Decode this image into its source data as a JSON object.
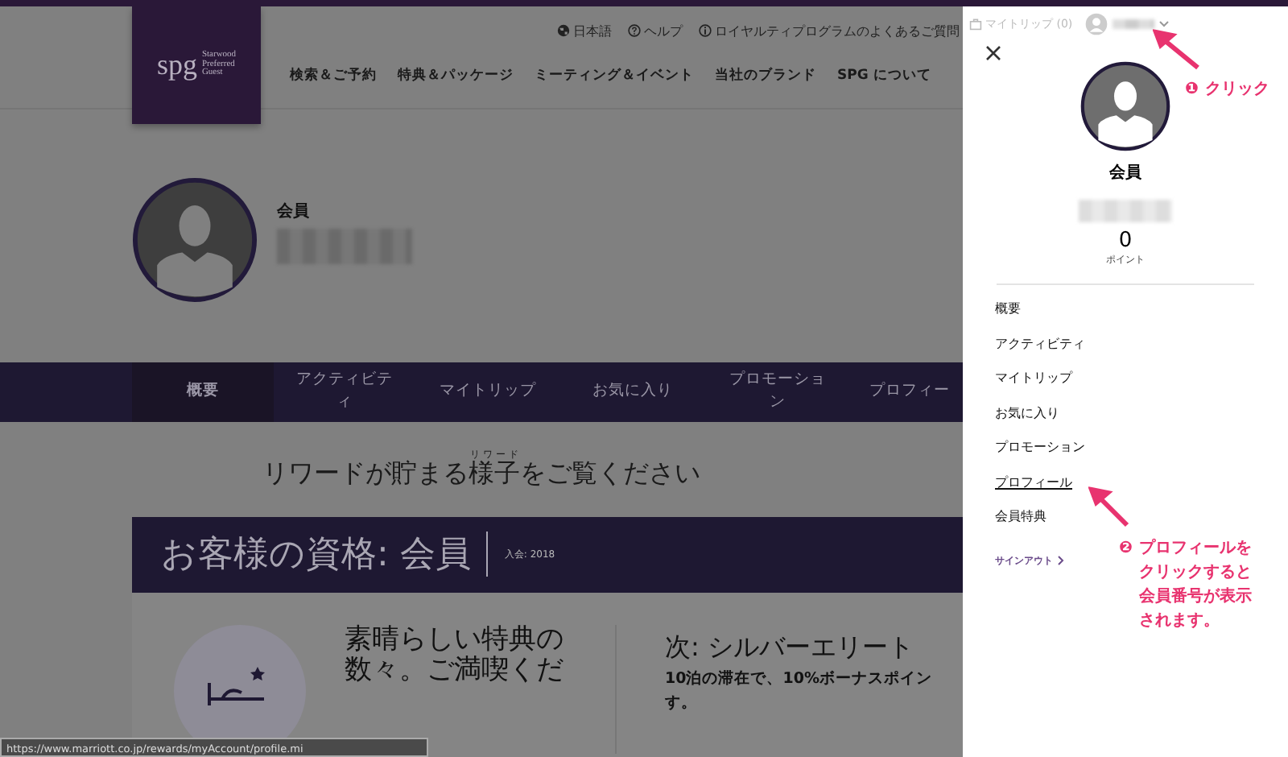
{
  "logo": {
    "mark": "spg",
    "words": [
      "Starwood",
      "Preferred",
      "Guest"
    ]
  },
  "utility_links": [
    {
      "kind": "globe",
      "label": "日本語"
    },
    {
      "kind": "help",
      "label": "ヘルプ"
    },
    {
      "kind": "info",
      "label": "ロイヤルティプログラムのよくあるご質問"
    }
  ],
  "main_nav": [
    "検索＆ご予約",
    "特典＆パッケージ",
    "ミーティング＆イベント",
    "当社のブランド",
    "SPG について"
  ],
  "profile": {
    "tier": "会員"
  },
  "tabs": [
    {
      "label": "概要",
      "selected": true
    },
    {
      "label": "アクティビティ",
      "selected": false
    },
    {
      "label": "マイトリップ",
      "selected": false
    },
    {
      "label": "お気に入り",
      "selected": false
    },
    {
      "label": "プロモーション",
      "selected": false
    },
    {
      "label": "プロフィー",
      "selected": false
    }
  ],
  "rewards_heading": {
    "before": "リワードが貯まる",
    "base": "様子",
    "ruby": "リワード",
    "after": "をご覧ください"
  },
  "status_banner": {
    "title": "お客様の資格: 会員",
    "joined": "入会: 2018"
  },
  "benefits": {
    "text": "素晴らしい特典の数々。ご満喫くだ"
  },
  "next_tier": {
    "title": "次: シルバーエリート",
    "line_1": "10泊の滞在で、10%ボーナスポイン",
    "line_2": "す。"
  },
  "status_url": "https://www.marriott.co.jp/rewards/myAccount/profile.mi",
  "drawer": {
    "my_trips": "マイトリップ (0)",
    "tier": "会員",
    "points": "0",
    "points_label": "ポイント",
    "menu": [
      {
        "label": "概要",
        "hovered": false
      },
      {
        "label": "アクティビティ",
        "hovered": false
      },
      {
        "label": "マイトリップ",
        "hovered": false
      },
      {
        "label": "お気に入り",
        "hovered": false
      },
      {
        "label": "プロモーション",
        "hovered": false
      },
      {
        "label": "プロフィール",
        "hovered": true
      },
      {
        "label": "会員特典",
        "hovered": false
      }
    ],
    "sign_out": "サインアウト"
  },
  "annotations": [
    {
      "number": "❶",
      "text": "クリック"
    },
    {
      "number": "❷",
      "text": "プロフィールをクリックすると会員番号が表示されます。"
    }
  ]
}
